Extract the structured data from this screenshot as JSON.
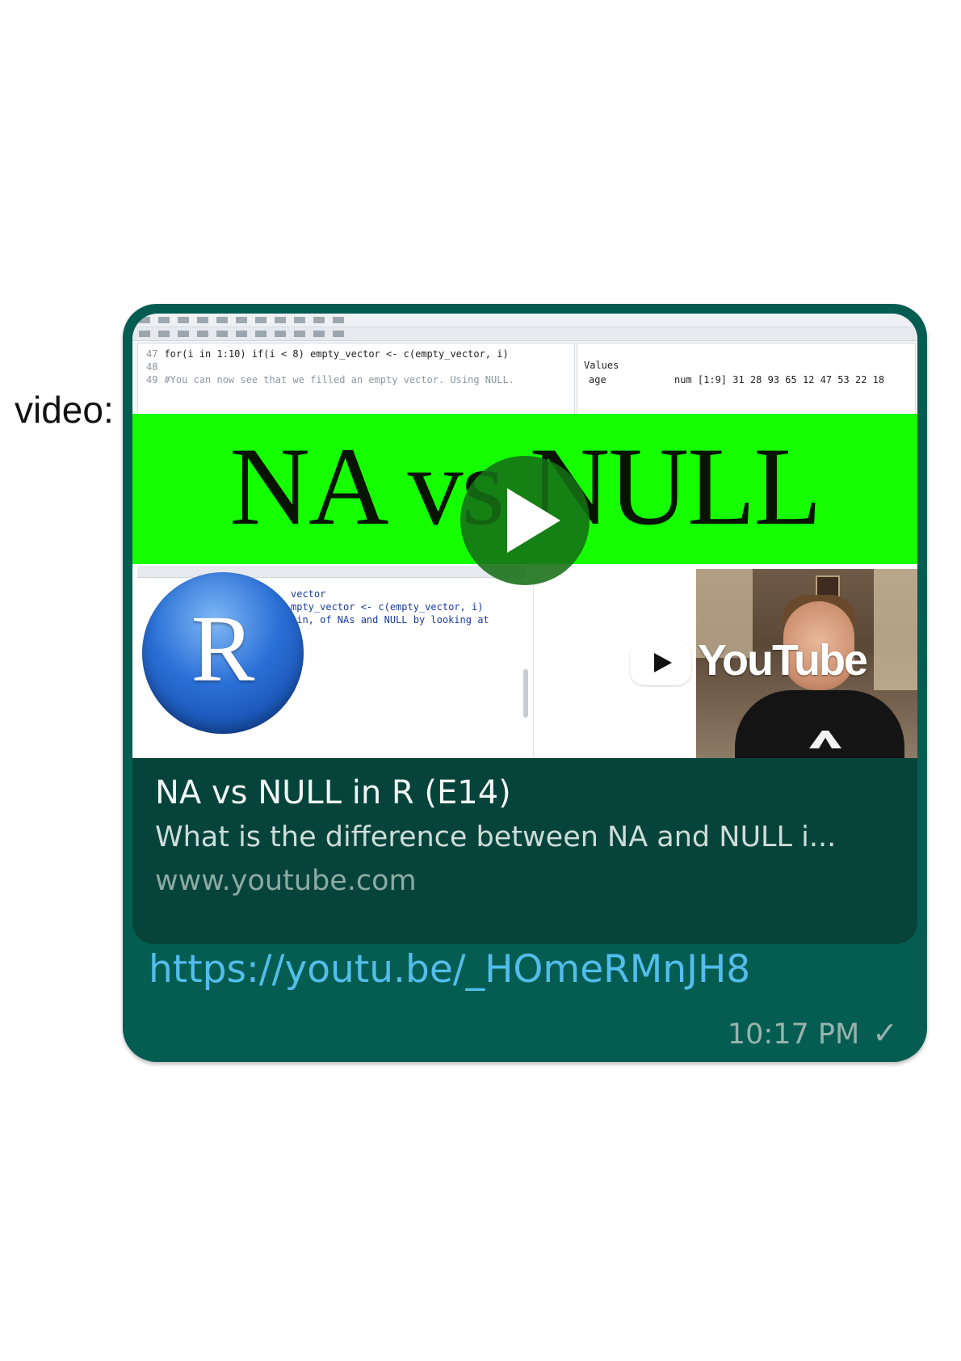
{
  "side_label": "video:",
  "thumbnail": {
    "editor_lines": [
      {
        "ln": "47",
        "code": "for(i in 1:10) if(i < 8) empty_vector <- c(empty_vector, i)"
      },
      {
        "ln": "48",
        "code": ""
      },
      {
        "ln": "49",
        "code": "#You can now see that we filled an empty vector. Using NULL."
      }
    ],
    "env_header": "Values",
    "env_row_name": "age",
    "env_row_value": "num [1:9] 31 28 93 65 12 47 53 22 18",
    "banner_text": "NA vs NULL",
    "console_lines": [
      "vector",
      "mpty_vector <- c(empty_vector, i)",
      "ain, of NAs and NULL by looking at"
    ],
    "r_logo_letter": "R",
    "youtube_word": "YouTube"
  },
  "preview": {
    "title": "NA vs NULL in R (E14)",
    "description": "What is the difference between NA and NULL i...",
    "domain": "www.youtube.com"
  },
  "message": {
    "link": "https://youtu.be/_HOmeRMnJH8",
    "time": "10:17 PM",
    "status_icon": "check-icon"
  },
  "colors": {
    "bubble": "#055d52",
    "preview_bg": "#06443b",
    "banner": "#15ff00",
    "link": "#53bdeb"
  }
}
